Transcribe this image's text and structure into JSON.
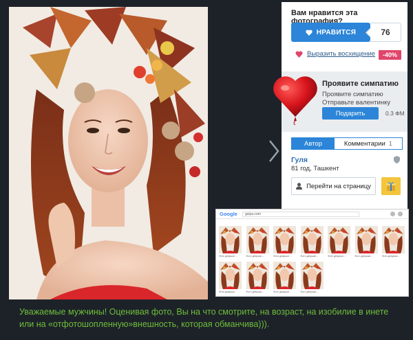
{
  "panel": {
    "question": "Вам нравится эта фотография?",
    "like_label": "НРАВИТСЯ",
    "like_count": "76",
    "admire_link": "Выразить восхищение",
    "discount": "-40%"
  },
  "sympathy": {
    "title": "Проявите симпатию",
    "line1": "Проявите симпатию",
    "line2": "Отправьте валентинку",
    "gift_button": "Подарить",
    "price": "0.3 ФМ"
  },
  "tabs": {
    "author": "Автор",
    "comments": "Комментарии",
    "comments_count": "1"
  },
  "author": {
    "name": "Гуля",
    "info": "81 год, Ташкент",
    "goto_button": "Перейти на страницу"
  },
  "google_shot": {
    "logo": "Google",
    "query": "gulya.com",
    "rows": [
      {
        "count": 7,
        "caption": "Фото девушки ..."
      },
      {
        "count": 4,
        "caption": "Фото девушки ..."
      }
    ]
  },
  "caption": "Уважаемые мужчины! Оценивая фото, Вы на что смотрите, на возраст, на изобилие в инете или на «отфотошопленную»внешность, которая обманчива))).",
  "colors": {
    "accent": "#2c85d8",
    "caption": "#6fbe3a",
    "discount": "#e0456a",
    "background": "#1d2229"
  },
  "icons": {
    "like": "heart-icon",
    "admire": "heart-small-icon",
    "goto": "user-icon",
    "gift": "gift-icon",
    "shield": "shield-icon",
    "next": "chevron-right-icon"
  }
}
